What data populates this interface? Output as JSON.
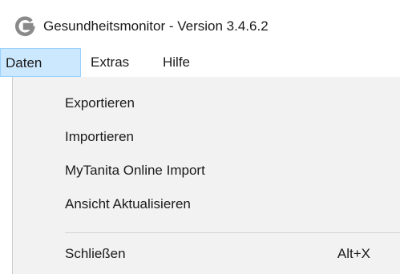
{
  "window": {
    "title": "Gesundheitsmonitor - Version 3.4.6.2",
    "icon": "G-logo-icon",
    "icon_color": "#8a8a8a"
  },
  "menubar": {
    "items": [
      {
        "label": "Daten",
        "active": true
      },
      {
        "label": "Extras",
        "active": false
      },
      {
        "label": "Hilfe",
        "active": false
      }
    ]
  },
  "dropdown": {
    "items": [
      {
        "label": "Exportieren"
      },
      {
        "label": "Importieren"
      },
      {
        "label": "MyTanita Online Import"
      },
      {
        "label": "Ansicht Aktualisieren"
      },
      {
        "label": "Schließen",
        "shortcut": "Alt+X"
      }
    ]
  },
  "colors": {
    "menubar_active_bg": "#cce8ff",
    "menubar_active_border": "#99d1ff",
    "dropdown_bg": "#f2f2f2"
  }
}
